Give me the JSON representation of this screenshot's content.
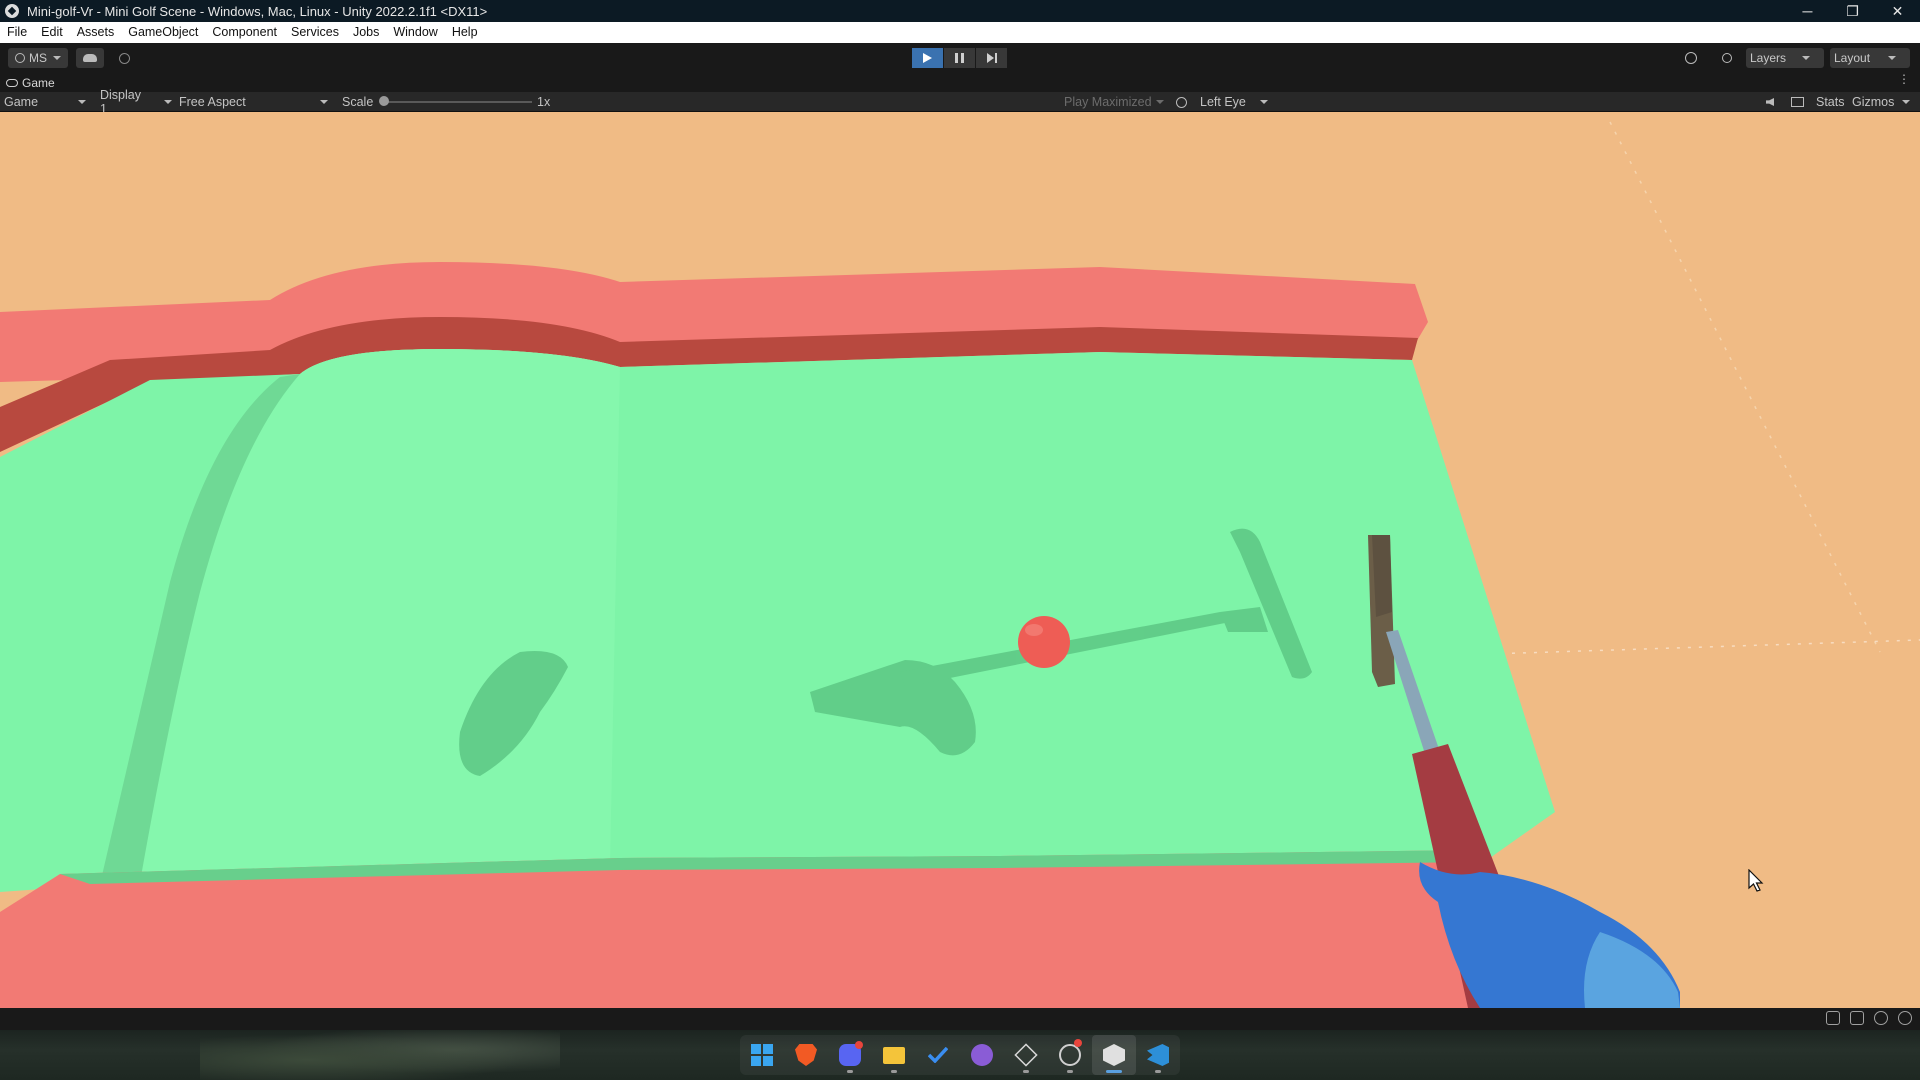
{
  "window": {
    "title": "Mini-golf-Vr - Mini Golf Scene - Windows, Mac, Linux - Unity 2022.2.1f1 <DX11>",
    "controls": {
      "minimize": "─",
      "restore": "❐",
      "close": "✕"
    }
  },
  "menu": {
    "items": [
      "File",
      "Edit",
      "Assets",
      "GameObject",
      "Component",
      "Services",
      "Jobs",
      "Window",
      "Help"
    ]
  },
  "toolbar": {
    "account": "MS",
    "layers": "Layers",
    "layout": "Layout",
    "play_state": "playing"
  },
  "game_tab": {
    "label": "Game"
  },
  "game_bar": {
    "view_mode": "Game",
    "display": "Display 1",
    "aspect": "Free Aspect",
    "scale_label": "Scale",
    "scale_value": "1x",
    "scale_fraction": 0.0,
    "play_maximized": "Play Maximized",
    "eye": "Left Eye",
    "stats": "Stats",
    "gizmos": "Gizmos"
  },
  "scene": {
    "sky_color": "#f0bb85",
    "green_color": "#7ef4a8",
    "wall_color": "#f27a74",
    "ball_color": "#ee5d55",
    "hand_color": "#3577d2"
  },
  "taskbar": {
    "apps": [
      {
        "name": "start-menu-icon",
        "active": false
      },
      {
        "name": "brave-browser-icon",
        "active": false
      },
      {
        "name": "discord-icon",
        "active": false,
        "badge": true
      },
      {
        "name": "file-explorer-icon",
        "active": false
      },
      {
        "name": "todo-icon",
        "active": false
      },
      {
        "name": "github-desktop-icon",
        "active": false
      },
      {
        "name": "unity-icon",
        "active": false
      },
      {
        "name": "obs-icon",
        "active": false,
        "badge": true
      },
      {
        "name": "unity-hub-icon",
        "active": true
      },
      {
        "name": "vscode-icon",
        "active": false
      }
    ]
  }
}
